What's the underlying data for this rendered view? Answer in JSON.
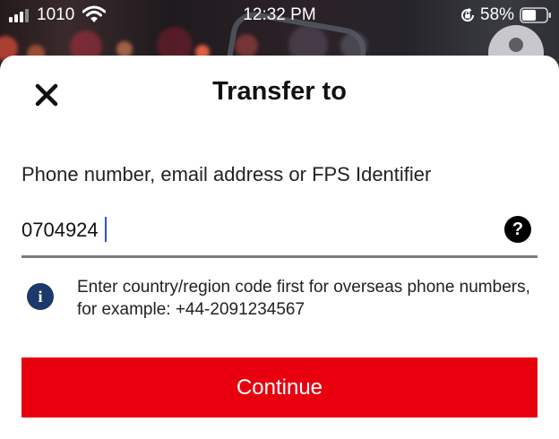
{
  "status_bar": {
    "carrier": "1010",
    "time": "12:32 PM",
    "battery_percent": "58%",
    "battery_level": 0.58,
    "icons": [
      "signal-bars-icon",
      "wifi-icon",
      "orientation-lock-icon",
      "battery-icon"
    ]
  },
  "sheet": {
    "close_icon": "close-icon",
    "title": "Transfer to",
    "field_label": "Phone number, email address or FPS Identifier",
    "input_value": "0704924",
    "input_placeholder": "",
    "help_icon": "?",
    "info_icon": "i",
    "info_text": "Enter country/region code first for overseas phone numbers, for example: +44-2091234567",
    "continue_label": "Continue"
  },
  "colors": {
    "accent": "#e8000e",
    "info_icon_bg": "#1b3a6b",
    "cursor": "#2f4fd8",
    "underline": "#7a7a7a"
  }
}
